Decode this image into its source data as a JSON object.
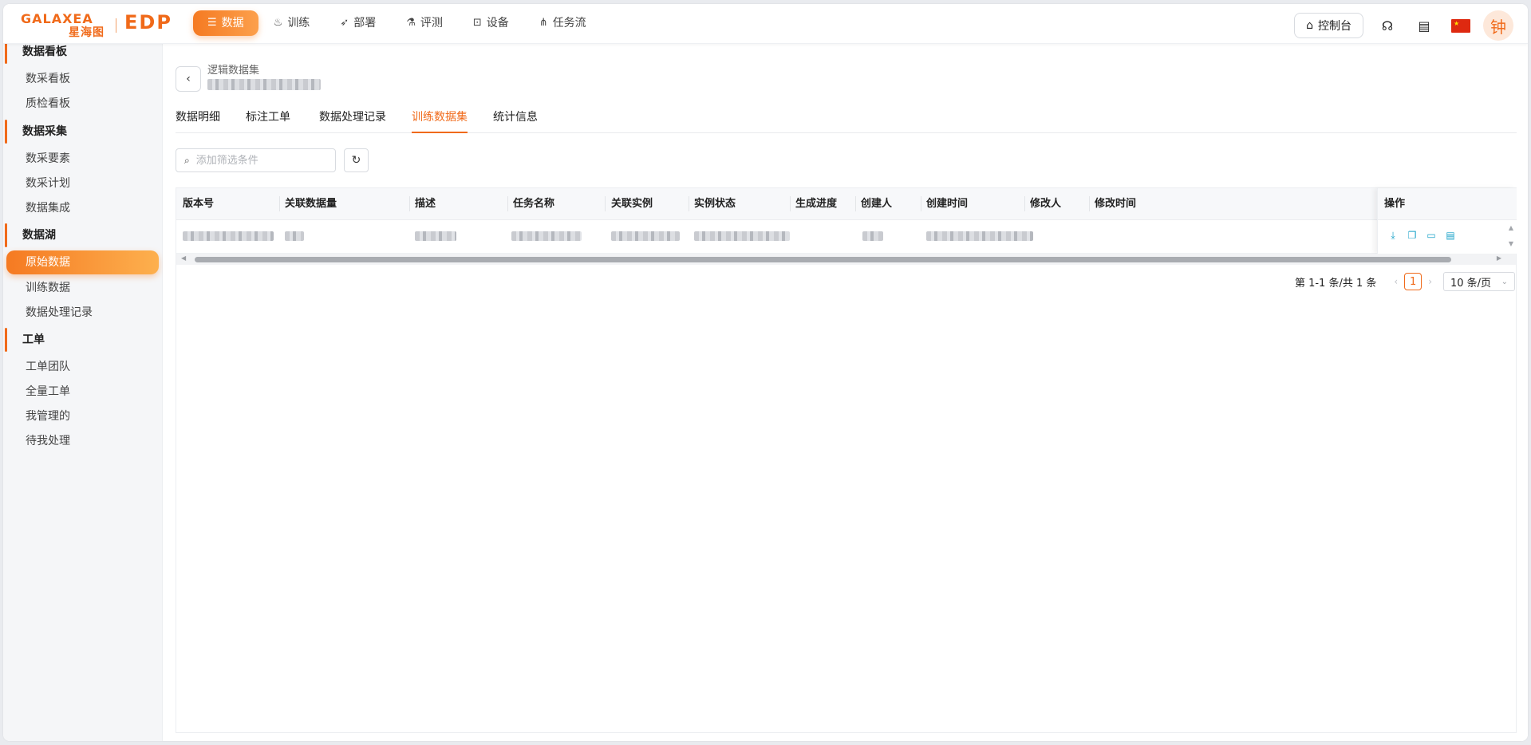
{
  "brand": {
    "logo_en": "GALAXEA",
    "logo_cn": "星海图",
    "product": "EDP",
    "accent": "#f06a1a"
  },
  "nav": {
    "items": [
      {
        "label": "数据",
        "icon": "database-icon",
        "active": true
      },
      {
        "label": "训练",
        "icon": "flame-icon"
      },
      {
        "label": "部署",
        "icon": "rocket-icon"
      },
      {
        "label": "评测",
        "icon": "flask-icon"
      },
      {
        "label": "设备",
        "icon": "robot-icon"
      },
      {
        "label": "任务流",
        "icon": "workflow-icon"
      }
    ]
  },
  "header": {
    "console_label": "控制台",
    "avatar_text": "钟"
  },
  "sidebar": {
    "groups": [
      {
        "title": "数据看板",
        "items": [
          "数采看板",
          "质检看板"
        ]
      },
      {
        "title": "数据采集",
        "items": [
          "数采要素",
          "数采计划",
          "数据集成"
        ]
      },
      {
        "title": "数据湖",
        "items": [
          "原始数据",
          "训练数据",
          "数据处理记录"
        ]
      },
      {
        "title": "工单",
        "items": [
          "工单团队",
          "全量工单",
          "我管理的",
          "待我处理"
        ]
      }
    ],
    "active_item": "原始数据"
  },
  "page": {
    "breadcrumb": "逻辑数据集",
    "tabs": [
      "数据明细",
      "标注工单",
      "数据处理记录",
      "训练数据集",
      "统计信息"
    ],
    "active_tab": "训练数据集",
    "filter_placeholder": "添加筛选条件"
  },
  "table": {
    "columns": [
      "版本号",
      "关联数据量",
      "描述",
      "任务名称",
      "关联实例",
      "实例状态",
      "生成进度",
      "创建人",
      "创建时间",
      "修改人",
      "修改时间"
    ],
    "ops_header": "操作",
    "ops_icons": [
      "download-icon",
      "copy-icon",
      "folder-icon",
      "document-icon"
    ]
  },
  "pagination": {
    "total_text": "第 1-1 条/共 1 条",
    "current_page": "1",
    "page_size": "10 条/页"
  }
}
